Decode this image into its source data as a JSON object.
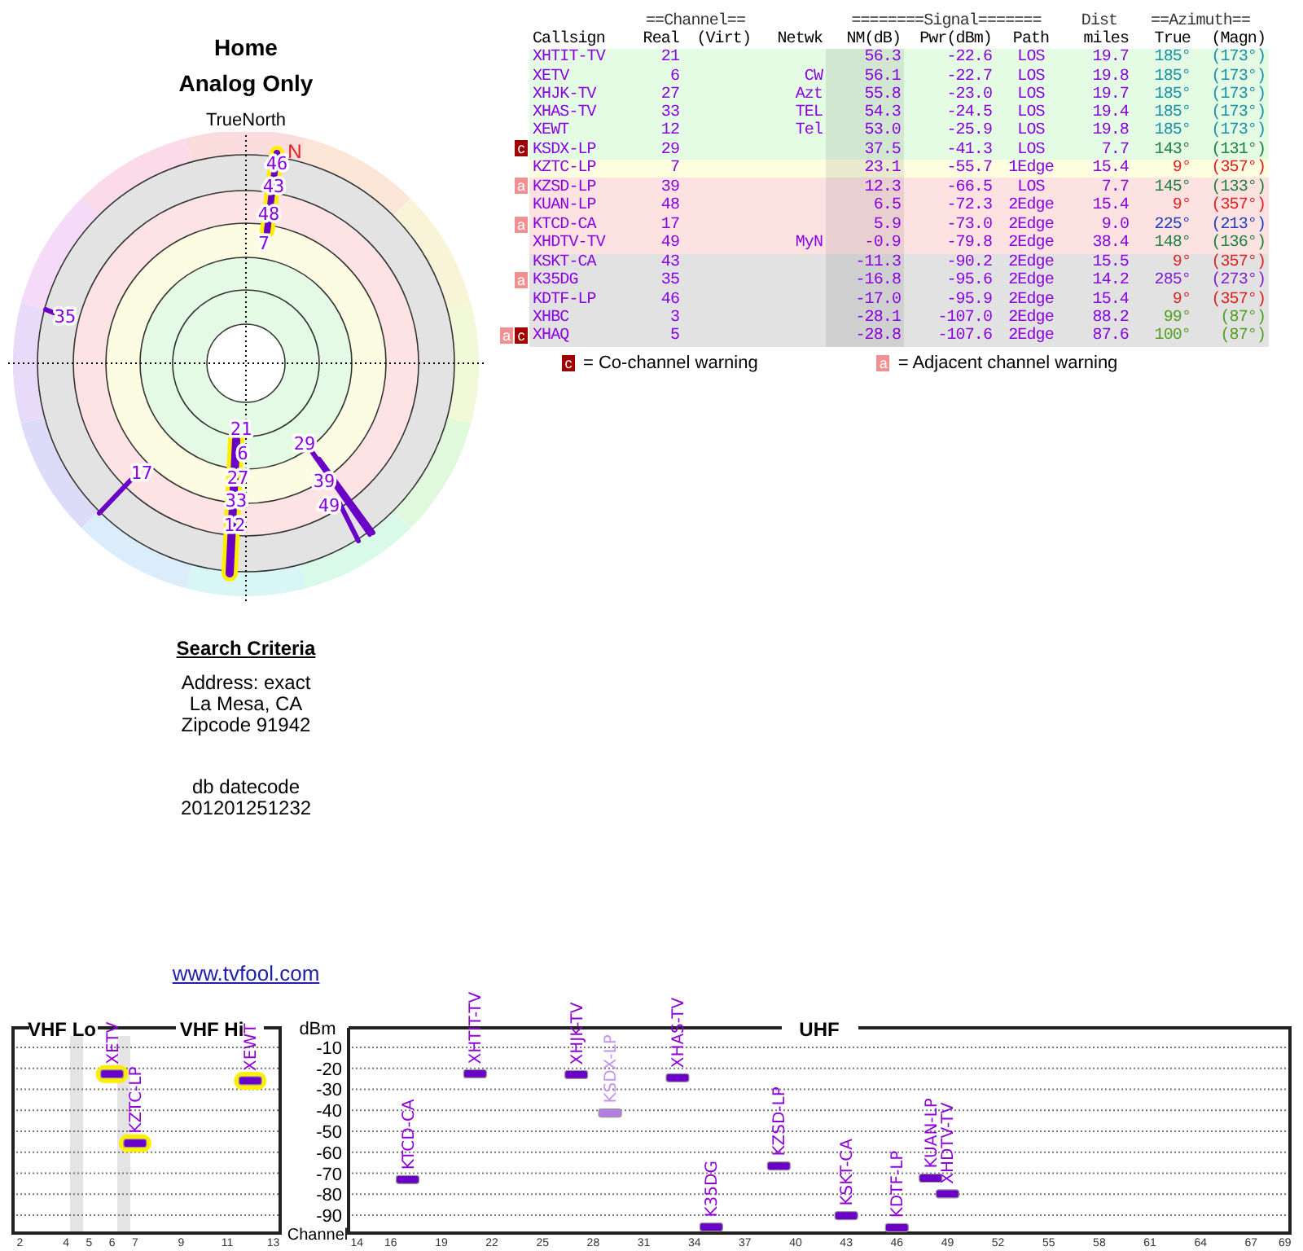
{
  "header": {
    "title": "Home",
    "subtitle": "Analog Only"
  },
  "polar": {
    "north_label": "TrueNorth",
    "n_label": "N",
    "labels": [
      "46",
      "43",
      "48",
      "7",
      "35",
      "21",
      "6",
      "27",
      "33",
      "12",
      "17",
      "29",
      "39",
      "49"
    ]
  },
  "search_criteria": {
    "title": "Search Criteria",
    "lines": [
      "Address: exact",
      "La Mesa, CA",
      "Zipcode 91942"
    ],
    "datecode_label": "db datecode",
    "datecode": "201201251232"
  },
  "link": "www.tvfool.com",
  "table": {
    "header_groups": [
      "==Channel==",
      "========Signal=======",
      "Dist",
      "==Azimuth=="
    ],
    "columns": [
      "Callsign",
      "Real",
      "(Virt)",
      "Netwk",
      "NM(dB)",
      "Pwr(dBm)",
      "Path",
      "miles",
      "True",
      "(Magn)"
    ],
    "rows": [
      {
        "callsign": "XHTIT-TV",
        "real": "21",
        "netwk": "",
        "nm": "56.3",
        "pwr": "-22.6",
        "path": "LOS",
        "dist": "19.7",
        "azimuth": {
          "true": "185°",
          "magn": "(173°)",
          "color": "#1890a8"
        },
        "color": "#e4fbe4",
        "warnings": []
      },
      {
        "callsign": "XETV",
        "real": "6",
        "netwk": "CW",
        "nm": "56.1",
        "pwr": "-22.7",
        "path": "LOS",
        "dist": "19.8",
        "azimuth": {
          "true": "185°",
          "magn": "(173°)",
          "color": "#1890a8"
        },
        "color": "#e4fbe4",
        "warnings": []
      },
      {
        "callsign": "XHJK-TV",
        "real": "27",
        "netwk": "Azt",
        "nm": "55.8",
        "pwr": "-23.0",
        "path": "LOS",
        "dist": "19.7",
        "azimuth": {
          "true": "185°",
          "magn": "(173°)",
          "color": "#1890a8"
        },
        "color": "#e4fbe4",
        "warnings": []
      },
      {
        "callsign": "XHAS-TV",
        "real": "33",
        "netwk": "TEL",
        "nm": "54.3",
        "pwr": "-24.5",
        "path": "LOS",
        "dist": "19.4",
        "azimuth": {
          "true": "185°",
          "magn": "(173°)",
          "color": "#1890a8"
        },
        "color": "#e4fbe4",
        "warnings": []
      },
      {
        "callsign": "XEWT",
        "real": "12",
        "netwk": "Tel",
        "nm": "53.0",
        "pwr": "-25.9",
        "path": "LOS",
        "dist": "19.8",
        "azimuth": {
          "true": "185°",
          "magn": "(173°)",
          "color": "#1890a8"
        },
        "color": "#e4fbe4",
        "warnings": []
      },
      {
        "callsign": "KSDX-LP",
        "real": "29",
        "netwk": "",
        "nm": "37.5",
        "pwr": "-41.3",
        "path": "LOS",
        "dist": "7.7",
        "azimuth": {
          "true": "143°",
          "magn": "(131°)",
          "color": "#208040"
        },
        "color": "#e4fbe4",
        "warnings": [
          {
            "kind": "co",
            "text": "c"
          }
        ]
      },
      {
        "callsign": "KZTC-LP",
        "real": "7",
        "netwk": "",
        "nm": "23.1",
        "pwr": "-55.7",
        "path": "1Edge",
        "dist": "15.4",
        "azimuth": {
          "true": "9°",
          "magn": "(357°)",
          "color": "#e02020"
        },
        "color": "#fdfde0",
        "warnings": []
      },
      {
        "callsign": "KZSD-LP",
        "real": "39",
        "netwk": "",
        "nm": "12.3",
        "pwr": "-66.5",
        "path": "LOS",
        "dist": "7.7",
        "azimuth": {
          "true": "145°",
          "magn": "(133°)",
          "color": "#208040"
        },
        "color": "#fde2e2",
        "warnings": [
          {
            "kind": "adjacent",
            "text": "a"
          }
        ]
      },
      {
        "callsign": "KUAN-LP",
        "real": "48",
        "netwk": "",
        "nm": "6.5",
        "pwr": "-72.3",
        "path": "2Edge",
        "dist": "15.4",
        "azimuth": {
          "true": "9°",
          "magn": "(357°)",
          "color": "#e02020"
        },
        "color": "#fde2e2",
        "warnings": []
      },
      {
        "callsign": "KTCD-CA",
        "real": "17",
        "netwk": "",
        "nm": "5.9",
        "pwr": "-73.0",
        "path": "2Edge",
        "dist": "9.0",
        "azimuth": {
          "true": "225°",
          "magn": "(213°)",
          "color": "#2040c0"
        },
        "color": "#fde2e2",
        "warnings": [
          {
            "kind": "adjacent",
            "text": "a"
          }
        ]
      },
      {
        "callsign": "XHDTV-TV",
        "real": "49",
        "netwk": "MyN",
        "nm": "-0.9",
        "pwr": "-79.8",
        "path": "2Edge",
        "dist": "38.4",
        "azimuth": {
          "true": "148°",
          "magn": "(136°)",
          "color": "#208040"
        },
        "color": "#fde2e2",
        "warnings": []
      },
      {
        "callsign": "KSKT-CA",
        "real": "43",
        "netwk": "",
        "nm": "-11.3",
        "pwr": "-90.2",
        "path": "2Edge",
        "dist": "15.5",
        "azimuth": {
          "true": "9°",
          "magn": "(357°)",
          "color": "#e02020"
        },
        "color": "#e2e2e2",
        "warnings": []
      },
      {
        "callsign": "K35DG",
        "real": "35",
        "netwk": "",
        "nm": "-16.8",
        "pwr": "-95.6",
        "path": "2Edge",
        "dist": "14.2",
        "azimuth": {
          "true": "285°",
          "magn": "(273°)",
          "color": "#8020d0"
        },
        "color": "#e2e2e2",
        "warnings": [
          {
            "kind": "adjacent",
            "text": "a"
          }
        ]
      },
      {
        "callsign": "KDTF-LP",
        "real": "46",
        "netwk": "",
        "nm": "-17.0",
        "pwr": "-95.9",
        "path": "2Edge",
        "dist": "15.4",
        "azimuth": {
          "true": "9°",
          "magn": "(357°)",
          "color": "#e02020"
        },
        "color": "#e2e2e2",
        "warnings": []
      },
      {
        "callsign": "XHBC",
        "real": "3",
        "netwk": "",
        "nm": "-28.1",
        "pwr": "-107.0",
        "path": "2Edge",
        "dist": "88.2",
        "azimuth": {
          "true": "99°",
          "magn": "(87°)",
          "color": "#50a020"
        },
        "color": "#e2e2e2",
        "warnings": []
      },
      {
        "callsign": "XHAQ",
        "real": "5",
        "netwk": "",
        "nm": "-28.8",
        "pwr": "-107.6",
        "path": "2Edge",
        "dist": "87.6",
        "azimuth": {
          "true": "100°",
          "magn": "(87°)",
          "color": "#50a020"
        },
        "color": "#e2e2e2",
        "warnings": [
          {
            "kind": "adjacent",
            "text": "a"
          },
          {
            "kind": "co",
            "text": "c"
          }
        ]
      }
    ]
  },
  "legend": [
    {
      "kind": "co",
      "mark": "c",
      "text": "= Co-channel warning"
    },
    {
      "kind": "adjacent",
      "mark": "a",
      "text": "= Adjacent channel warning"
    }
  ],
  "vhf": {
    "band_labels": [
      "VHF Lo",
      "VHF Hi"
    ],
    "stations": [
      {
        "callsign": "XETV",
        "highlight": true
      },
      {
        "callsign": "KZTC-LP",
        "highlight": true
      },
      {
        "callsign": "XEWT",
        "highlight": true
      }
    ],
    "chart_data": {
      "type": "scatter",
      "x": [
        6,
        7,
        12
      ],
      "series": [
        {
          "color": "#6a00c8",
          "values": [
            -22.7,
            -55.7,
            -25.9
          ]
        }
      ],
      "xlim": [
        1.7,
        13.3
      ],
      "ylim": [
        -98.5,
        -0.7
      ],
      "grid": true,
      "xticks": [
        2,
        4,
        5,
        6,
        7,
        9,
        11,
        13
      ]
    }
  },
  "uhf": {
    "stations": [
      {
        "callsign": "KTCD-CA",
        "highlight": false
      },
      {
        "callsign": "XHTIT-TV",
        "highlight": false
      },
      {
        "callsign": "XHJK-TV",
        "highlight": false
      },
      {
        "callsign": "KSDX-LP",
        "highlight": false
      },
      {
        "callsign": "XHAS-TV",
        "highlight": false
      },
      {
        "callsign": "K35DG",
        "highlight": false
      },
      {
        "callsign": "KZSD-LP",
        "highlight": false
      },
      {
        "callsign": "KSKT-CA",
        "highlight": false
      },
      {
        "callsign": "KDTF-LP",
        "highlight": false
      },
      {
        "callsign": "KUAN-LP",
        "highlight": false
      },
      {
        "callsign": "XHDTV-TV",
        "highlight": false
      }
    ],
    "chart_data": {
      "type": "scatter",
      "title": "UHF",
      "xlabel": "Channel",
      "ylabel": "dBm",
      "x": [
        17,
        21,
        27,
        29,
        33,
        35,
        39,
        43,
        46,
        48,
        49
      ],
      "series": [
        {
          "color": "#6a00c8",
          "values": [
            -73.0,
            -22.6,
            -23.0,
            null,
            -24.5,
            -95.6,
            -66.5,
            -90.2,
            -95.9,
            -72.3,
            -79.8
          ]
        },
        {
          "color": "#b27ee6",
          "values": [
            null,
            null,
            null,
            -41.3,
            null,
            null,
            null,
            null,
            null,
            null,
            null
          ]
        }
      ],
      "xlim": [
        13.5,
        69.3
      ],
      "ylim": [
        -98.5,
        -0.7
      ],
      "grid": true,
      "xticks": [
        14,
        16,
        19,
        22,
        25,
        28,
        31,
        34,
        37,
        40,
        43,
        46,
        49,
        52,
        55,
        58,
        61,
        64,
        67,
        69
      ],
      "yticks": [
        -10,
        -20,
        -30,
        -40,
        -50,
        -60,
        -70,
        -80,
        -90
      ]
    }
  }
}
